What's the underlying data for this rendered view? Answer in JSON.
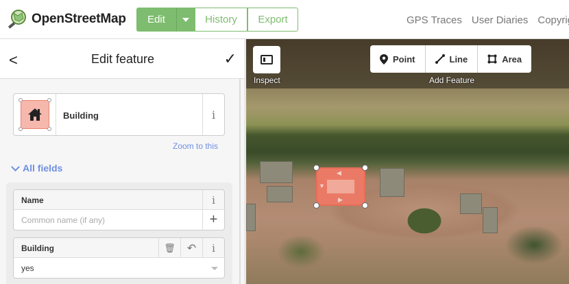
{
  "brand": {
    "name": "OpenStreetMap"
  },
  "header": {
    "edit_label": "Edit",
    "history_label": "History",
    "export_label": "Export",
    "nav": [
      "GPS Traces",
      "User Diaries",
      "Copyright"
    ]
  },
  "sidebar": {
    "back_glyph": "<",
    "title": "Edit feature",
    "done_glyph": "✓",
    "preset": {
      "name": "Building",
      "info_glyph": "i"
    },
    "zoom_link": "Zoom to this",
    "all_fields_label": "All fields",
    "fields": {
      "name": {
        "label": "Name",
        "placeholder": "Common name (if any)",
        "info_glyph": "i",
        "add_glyph": "+"
      },
      "building": {
        "label": "Building",
        "value": "yes",
        "info_glyph": "i",
        "delete_glyph": "🗑",
        "revert_glyph": "↶"
      }
    }
  },
  "map": {
    "inspect_label": "Inspect",
    "add_feature_label": "Add Feature",
    "modes": [
      {
        "label": "Point",
        "icon": "point-marker-icon"
      },
      {
        "label": "Line",
        "icon": "line-icon"
      },
      {
        "label": "Area",
        "icon": "area-icon"
      }
    ]
  },
  "colors": {
    "osm_green": "#7ebc6f",
    "link_blue": "#6f8fe0",
    "building_fill": "#ea7a66"
  }
}
